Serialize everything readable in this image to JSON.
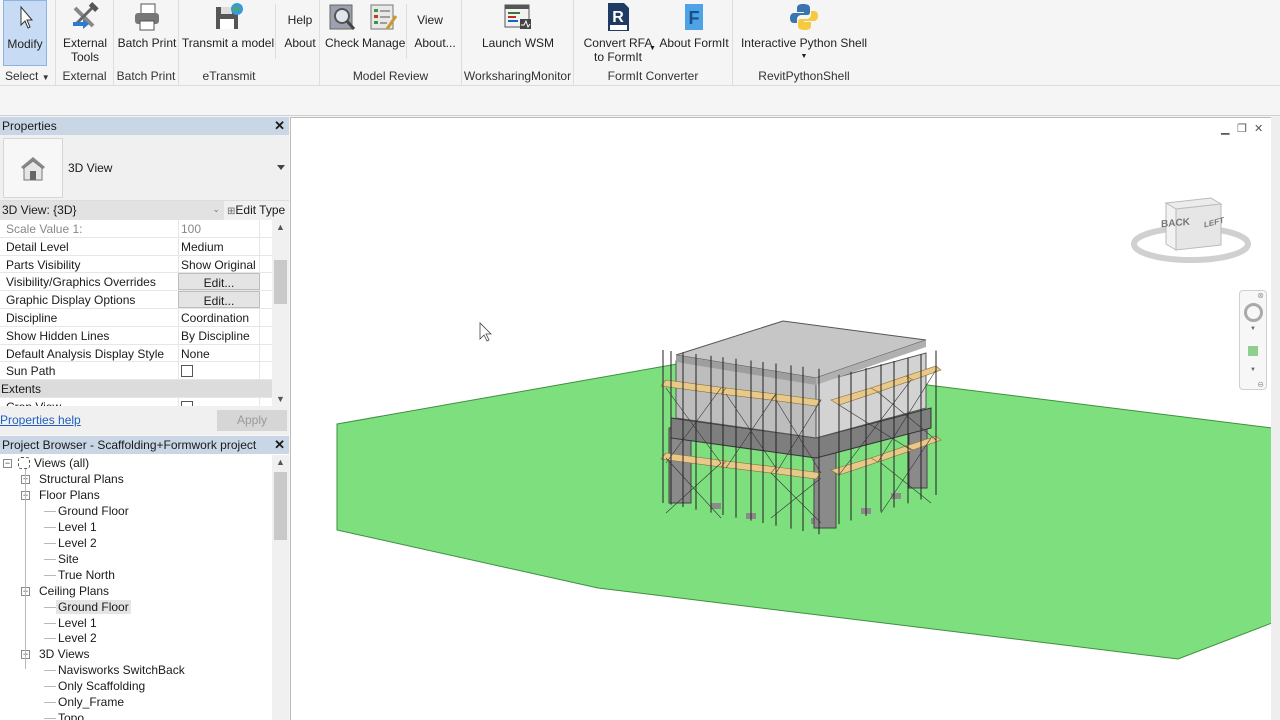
{
  "ribbon": {
    "panels": [
      {
        "label": "Select",
        "has_dropdown": true,
        "buttons": [
          {
            "label": "Modify",
            "icon": "cursor-arrow-icon",
            "active": true
          }
        ]
      },
      {
        "label": "External",
        "buttons": [
          {
            "label": "External Tools",
            "line1": "External",
            "line2": "Tools",
            "icon": "tools-wrench-hammer-icon",
            "has_dropdown": true
          }
        ]
      },
      {
        "label": "Batch Print",
        "buttons": [
          {
            "label": "Batch Print",
            "icon": "printer-icon"
          }
        ]
      },
      {
        "label": "eTransmit",
        "buttons": [
          {
            "label": "Transmit a model",
            "icon": "floppy-globe-icon"
          },
          {
            "label": "Help"
          },
          {
            "label": "About"
          }
        ]
      },
      {
        "label": "Model Review",
        "buttons": [
          {
            "label": "Check",
            "icon": "magnifier-check-icon"
          },
          {
            "label": "Manage",
            "icon": "checklist-pencil-icon"
          },
          {
            "label": "View"
          },
          {
            "label": "About..."
          }
        ]
      },
      {
        "label": "WorksharingMonitor",
        "buttons": [
          {
            "label": "Launch WSM",
            "icon": "monitor-window-icon"
          }
        ]
      },
      {
        "label": "FormIt Converter",
        "buttons": [
          {
            "label": "Convert RFA to FormIt",
            "line1": "Convert RFA",
            "line2": "to FormIt",
            "icon": "rfa-file-icon",
            "has_dropdown": true
          },
          {
            "label": "About FormIt",
            "icon": "formit-f-icon"
          }
        ]
      },
      {
        "label": "RevitPythonShell",
        "buttons": [
          {
            "label": "Interactive Python Shell",
            "icon": "python-logo-icon",
            "has_dropdown": true
          }
        ]
      }
    ]
  },
  "properties": {
    "title": "Properties",
    "type_name": "3D View",
    "instance_selector": "3D View: {3D}",
    "edit_type_label": "Edit Type",
    "rows": [
      {
        "key": "Scale Value    1:",
        "value": "100",
        "disabled": true
      },
      {
        "key": "Detail Level",
        "value": "Medium"
      },
      {
        "key": "Parts Visibility",
        "value": "Show Original"
      },
      {
        "key": "Visibility/Graphics Overrides",
        "value": "Edit...",
        "button": true
      },
      {
        "key": "Graphic Display Options",
        "value": "Edit...",
        "button": true
      },
      {
        "key": "Discipline",
        "value": "Coordination"
      },
      {
        "key": "Show Hidden Lines",
        "value": "By Discipline"
      },
      {
        "key": "Default Analysis Display Style",
        "value": "None"
      },
      {
        "key": "Sun Path",
        "checkbox": true,
        "checked": false
      },
      {
        "key": "Extents",
        "group": true
      },
      {
        "key": "Crop View",
        "checkbox": true,
        "checked": false
      }
    ],
    "help_link": "Properties help",
    "apply_label": "Apply"
  },
  "project_browser": {
    "title": "Project Browser - Scaffolding+Formwork project",
    "tree": [
      {
        "label": "Views (all)",
        "level": 0,
        "expander": "-",
        "icon": "views-icon"
      },
      {
        "label": "Structural Plans",
        "level": 1,
        "expander": "+"
      },
      {
        "label": "Floor Plans",
        "level": 1,
        "expander": "-"
      },
      {
        "label": "Ground Floor",
        "level": 2
      },
      {
        "label": "Level 1",
        "level": 2
      },
      {
        "label": "Level 2",
        "level": 2
      },
      {
        "label": "Site",
        "level": 2
      },
      {
        "label": "True North",
        "level": 2
      },
      {
        "label": "Ceiling Plans",
        "level": 1,
        "expander": "-"
      },
      {
        "label": "Ground Floor",
        "level": 2,
        "selected": true
      },
      {
        "label": "Level 1",
        "level": 2
      },
      {
        "label": "Level 2",
        "level": 2
      },
      {
        "label": "3D Views",
        "level": 1,
        "expander": "-"
      },
      {
        "label": "Navisworks SwitchBack",
        "level": 2
      },
      {
        "label": "Only Scaffolding",
        "level": 2
      },
      {
        "label": "Only_Frame",
        "level": 2
      },
      {
        "label": "Topo",
        "level": 2
      }
    ]
  },
  "viewport": {
    "viewcube": {
      "front_face": "BACK",
      "side_face": "LEFT"
    },
    "window_controls": [
      "minimize",
      "restore",
      "close"
    ],
    "colors": {
      "topo": "#7ddf7d",
      "topo_edge": "#3f8f3f",
      "concrete": "#c9c9c9",
      "scaffold_deck": "#e8c98a",
      "steel": "#2b2b2b"
    }
  }
}
